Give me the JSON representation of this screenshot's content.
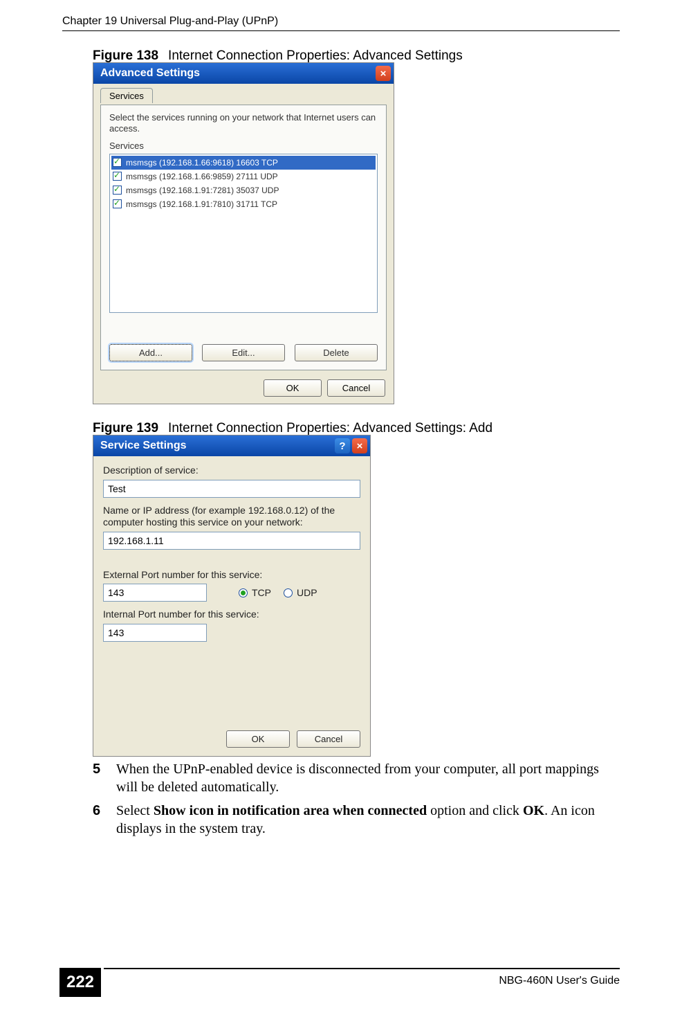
{
  "header": {
    "chapter": "Chapter 19 Universal Plug-and-Play (UPnP)"
  },
  "fig138": {
    "label": "Figure 138",
    "caption": "Internet Connection Properties: Advanced Settings",
    "title": "Advanced Settings",
    "tab": "Services",
    "instruction": "Select the services running on your network that Internet users can access.",
    "group_label": "Services",
    "services": [
      "msmsgs (192.168.1.66:9618) 16603 TCP",
      "msmsgs (192.168.1.66:9859) 27111 UDP",
      "msmsgs (192.168.1.91:7281) 35037 UDP",
      "msmsgs (192.168.1.91:7810) 31711 TCP"
    ],
    "buttons": {
      "add": "Add...",
      "edit": "Edit...",
      "delete": "Delete"
    },
    "footer": {
      "ok": "OK",
      "cancel": "Cancel"
    }
  },
  "fig139": {
    "label": "Figure 139",
    "caption": "Internet Connection Properties: Advanced Settings: Add",
    "title": "Service Settings",
    "labels": {
      "description": "Description of service:",
      "host": "Name or IP address (for example 192.168.0.12) of the computer hosting this service on your network:",
      "ext_port": "External Port number for this service:",
      "int_port": "Internal Port number for this service:",
      "tcp": "TCP",
      "udp": "UDP"
    },
    "values": {
      "description": "Test",
      "host": "192.168.1.11",
      "ext_port": "143",
      "int_port": "143"
    },
    "protocol_selected": "tcp",
    "footer": {
      "ok": "OK",
      "cancel": "Cancel"
    }
  },
  "steps": {
    "s5num": "5",
    "s5": "When the UPnP-enabled device is disconnected from your computer, all port mappings will be deleted automatically.",
    "s6num": "6",
    "s6a": "Select ",
    "s6bold": "Show icon in notification area when connected",
    "s6b": " option and click ",
    "s6ok": "OK",
    "s6c": ". An icon displays in the system tray."
  },
  "footer": {
    "page": "222",
    "guide": "NBG-460N User's Guide"
  }
}
